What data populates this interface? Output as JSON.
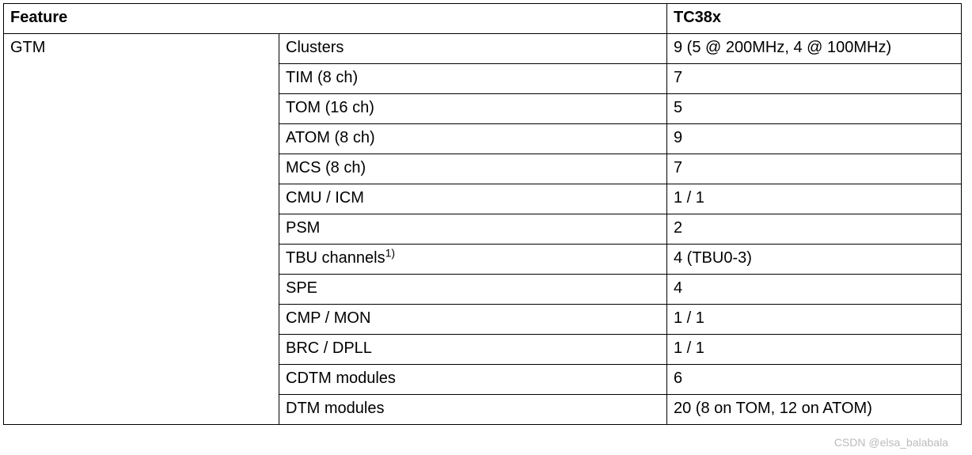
{
  "header": {
    "feature": "Feature",
    "value": "TC38x"
  },
  "feature_group": "GTM",
  "rows": [
    {
      "label": "Clusters",
      "value": "9 (5 @ 200MHz, 4 @ 100MHz)",
      "sup": ""
    },
    {
      "label": "TIM (8 ch)",
      "value": "7",
      "sup": ""
    },
    {
      "label": "TOM (16 ch)",
      "value": "5",
      "sup": ""
    },
    {
      "label": "ATOM (8 ch)",
      "value": "9",
      "sup": ""
    },
    {
      "label": "MCS (8 ch)",
      "value": "7",
      "sup": ""
    },
    {
      "label": "CMU / ICM",
      "value": "1 / 1",
      "sup": ""
    },
    {
      "label": "PSM",
      "value": "2",
      "sup": ""
    },
    {
      "label": "TBU channels",
      "value": "4 (TBU0-3)",
      "sup": "1)"
    },
    {
      "label": "SPE",
      "value": "4",
      "sup": ""
    },
    {
      "label": "CMP / MON",
      "value": "1 / 1",
      "sup": ""
    },
    {
      "label": "BRC / DPLL",
      "value": "1 / 1",
      "sup": ""
    },
    {
      "label": "CDTM modules",
      "value": "6",
      "sup": ""
    },
    {
      "label": "DTM modules",
      "value": "20 (8 on TOM, 12 on ATOM)",
      "sup": ""
    }
  ],
  "watermark": "CSDN @elsa_balabala"
}
